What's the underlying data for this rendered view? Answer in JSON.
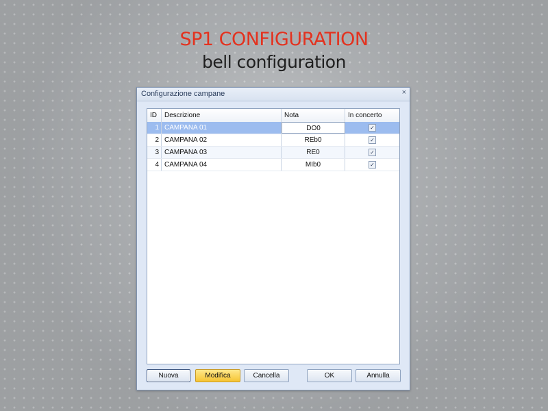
{
  "header": {
    "title": "SP1 CONFIGURATION",
    "subtitle": "bell configuration"
  },
  "dialog": {
    "title": "Configurazione campane",
    "close": "×"
  },
  "table": {
    "columns": [
      "ID",
      "Descrizione",
      "Nota",
      "In concerto"
    ],
    "rows": [
      {
        "id": "1",
        "descrizione": "CAMPANA 01",
        "nota": "DO0",
        "in_concerto": "✓"
      },
      {
        "id": "2",
        "descrizione": "CAMPANA 02",
        "nota": "REb0",
        "in_concerto": "✓"
      },
      {
        "id": "3",
        "descrizione": "CAMPANA 03",
        "nota": "RE0",
        "in_concerto": "✓"
      },
      {
        "id": "4",
        "descrizione": "CAMPANA 04",
        "nota": "MIb0",
        "in_concerto": "✓"
      }
    ]
  },
  "buttons": {
    "nuova": "Nuova",
    "modifica": "Modifica",
    "cancella": "Cancella",
    "ok": "OK",
    "annulla": "Annulla"
  },
  "colors": {
    "title": "#e3321f",
    "selected_row": "#9cbcef",
    "active_button": "#f6c433"
  }
}
